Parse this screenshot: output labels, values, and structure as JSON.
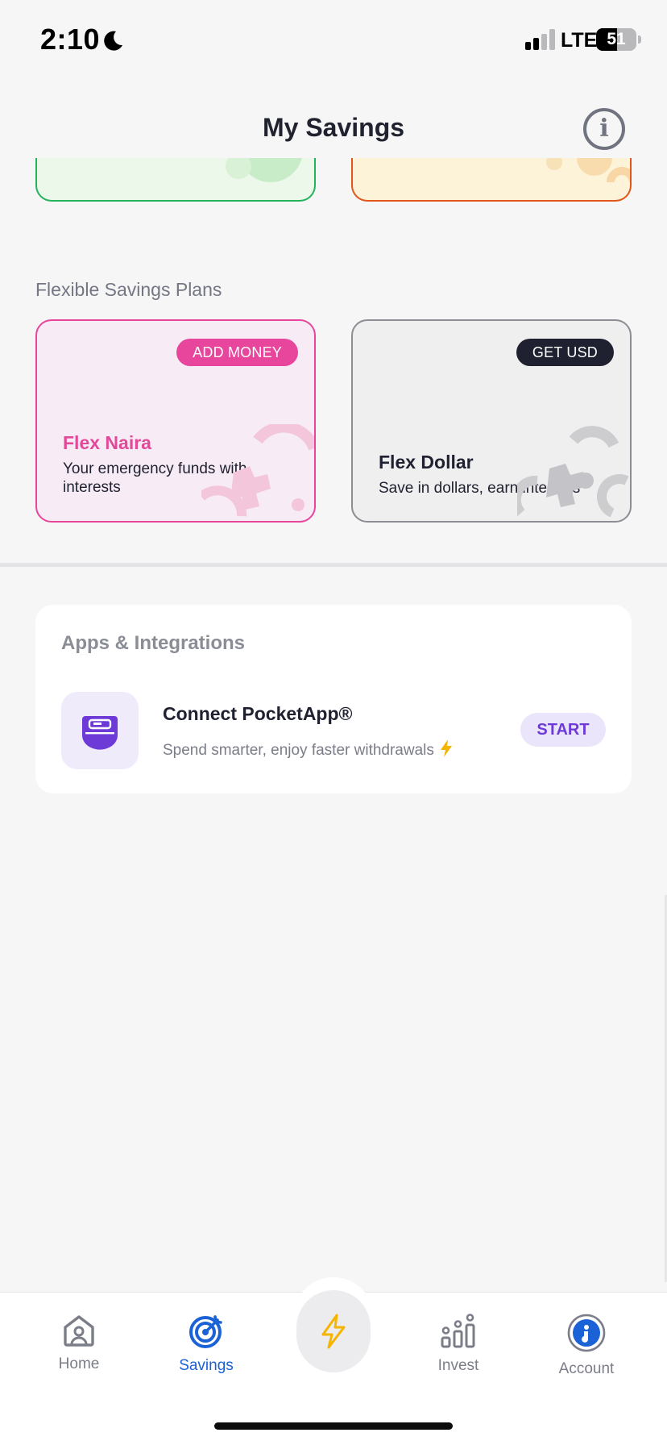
{
  "status_bar": {
    "time": "2:10",
    "network": "LTE",
    "battery": "51",
    "battery_level": 0.51
  },
  "header": {
    "title": "My Savings"
  },
  "flexible_section": {
    "label": "Flexible Savings Plans",
    "cards": [
      {
        "action_label": "ADD MONEY",
        "title": "Flex Naira",
        "description": "Your emergency funds with interests",
        "accent": "#e8459c"
      },
      {
        "action_label": "GET USD",
        "title": "Flex Dollar",
        "description": "Save in dollars, earn interests",
        "accent": "#1f2130"
      }
    ]
  },
  "apps": {
    "title": "Apps & Integrations",
    "item": {
      "name": "Connect PocketApp®",
      "description": "Spend smarter, enjoy faster withdrawals",
      "action_label": "START"
    }
  },
  "bottom_nav": {
    "items": [
      {
        "label": "Home",
        "icon": "home-icon",
        "active": false
      },
      {
        "label": "Savings",
        "icon": "target-icon",
        "active": true
      },
      {
        "label": "Invest",
        "icon": "invest-icon",
        "active": false
      },
      {
        "label": "Account",
        "icon": "account-icon",
        "active": false
      }
    ],
    "center_icon": "lightning-icon"
  },
  "colors": {
    "primary": "#1b62d6",
    "pink": "#e8459c",
    "purple": "#6d3ad8",
    "green_border": "#22b35b",
    "orange_border": "#e2561c",
    "bolt": "#f5b400"
  }
}
